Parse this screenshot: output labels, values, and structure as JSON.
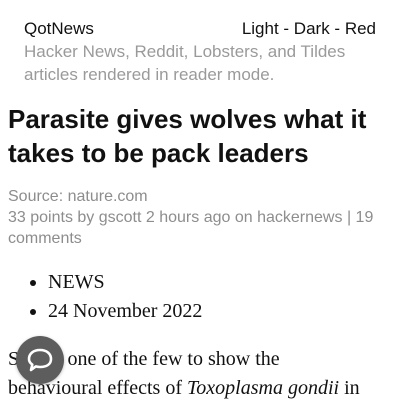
{
  "header": {
    "site_name": "QotNews",
    "themes": [
      "Light",
      "Dark",
      "Red"
    ],
    "separator": " - ",
    "tagline": "Hacker News, Reddit, Lobsters, and Tildes articles rendered in reader mode."
  },
  "article": {
    "title": "Parasite gives wolves what it takes to be pack leaders",
    "source_label": "Source:",
    "source": "nature.com",
    "points": "33 points",
    "by_label": "by",
    "author": "gscott",
    "time": "2 hours ago",
    "on_label": "on",
    "site": "hackernews",
    "divider": "|",
    "comments": "19 comments",
    "tags": [
      "NEWS",
      "24 November 2022"
    ],
    "body_start": "S",
    "body_line1_rest": "is one of the few to show the",
    "body_line2_start": "behavioural effects of",
    "body_line2_italic": "Toxoplasma gondii",
    "body_line2_end": "in"
  },
  "colors": {
    "muted_text": "#9a9a9a",
    "chat_button": "#5d5d5d"
  },
  "icons": {
    "chat": "speech-bubble-icon"
  }
}
